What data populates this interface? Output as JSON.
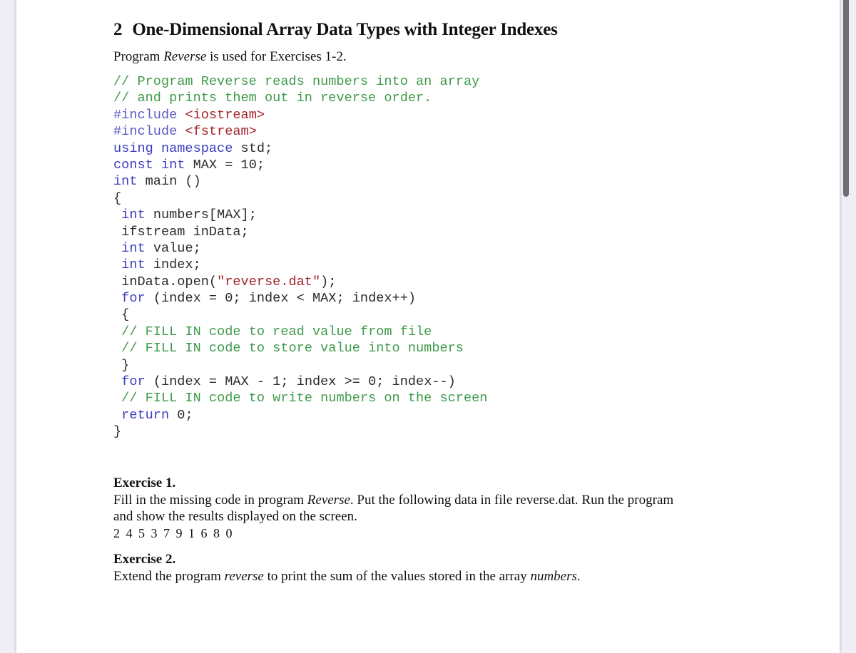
{
  "section": {
    "number": "2",
    "title": "One-Dimensional Array Data Types with Integer Indexes"
  },
  "intro": {
    "pre": "Program ",
    "italic": "Reverse",
    "post": " is used for Exercises 1-2."
  },
  "code": {
    "lines": [
      [
        {
          "t": "// Program Reverse reads numbers into an array",
          "c": "cm"
        }
      ],
      [
        {
          "t": "// and prints them out in reverse order.",
          "c": "cm"
        }
      ],
      [
        {
          "t": "#include",
          "c": "pp"
        },
        {
          "t": " ",
          "c": ""
        },
        {
          "t": "<iostream>",
          "c": "str"
        }
      ],
      [
        {
          "t": "#include",
          "c": "pp"
        },
        {
          "t": " ",
          "c": ""
        },
        {
          "t": "<fstream>",
          "c": "str"
        }
      ],
      [
        {
          "t": "using namespace",
          "c": "kw"
        },
        {
          "t": " std;",
          "c": ""
        }
      ],
      [
        {
          "t": "const int",
          "c": "kw"
        },
        {
          "t": " MAX = 10;",
          "c": ""
        }
      ],
      [
        {
          "t": "int",
          "c": "kw"
        },
        {
          "t": " main ()",
          "c": ""
        }
      ],
      [
        {
          "t": "{",
          "c": ""
        }
      ],
      [
        {
          "t": " ",
          "c": ""
        },
        {
          "t": "int",
          "c": "kw"
        },
        {
          "t": " numbers[MAX];",
          "c": ""
        }
      ],
      [
        {
          "t": " ifstream inData;",
          "c": ""
        }
      ],
      [
        {
          "t": " ",
          "c": ""
        },
        {
          "t": "int",
          "c": "kw"
        },
        {
          "t": " value;",
          "c": ""
        }
      ],
      [
        {
          "t": " ",
          "c": ""
        },
        {
          "t": "int",
          "c": "kw"
        },
        {
          "t": " index;",
          "c": ""
        }
      ],
      [
        {
          "t": " inData.open(",
          "c": ""
        },
        {
          "t": "\"reverse.dat\"",
          "c": "str"
        },
        {
          "t": ");",
          "c": ""
        }
      ],
      [
        {
          "t": " ",
          "c": ""
        },
        {
          "t": "for",
          "c": "kw"
        },
        {
          "t": " (index = 0; index < MAX; index++)",
          "c": ""
        }
      ],
      [
        {
          "t": " {",
          "c": ""
        }
      ],
      [
        {
          "t": " ",
          "c": ""
        },
        {
          "t": "// FILL IN code to read value from file",
          "c": "cm"
        }
      ],
      [
        {
          "t": " ",
          "c": ""
        },
        {
          "t": "// FILL IN code to store value into numbers",
          "c": "cm"
        }
      ],
      [
        {
          "t": " }",
          "c": ""
        }
      ],
      [
        {
          "t": " ",
          "c": ""
        },
        {
          "t": "for",
          "c": "kw"
        },
        {
          "t": " (index = MAX - 1; index >= 0; index--)",
          "c": ""
        }
      ],
      [
        {
          "t": " ",
          "c": ""
        },
        {
          "t": "// FILL IN code to write numbers on the screen",
          "c": "cm"
        }
      ],
      [
        {
          "t": " ",
          "c": ""
        },
        {
          "t": "return",
          "c": "kw"
        },
        {
          "t": " 0;",
          "c": ""
        }
      ],
      [
        {
          "t": "}",
          "c": ""
        }
      ]
    ]
  },
  "exercise1": {
    "title": "Exercise 1.",
    "line1_pre": "Fill in the missing code in program ",
    "line1_italic": "Reverse",
    "line1_post": ". Put the following data in file reverse.dat. Run the program",
    "line2": "and show the results displayed on the screen.",
    "data": "2 4 5 3 7 9 1 6 8 0"
  },
  "exercise2": {
    "title": "Exercise 2.",
    "pre": "Extend the program ",
    "italic1": "reverse",
    "mid": " to print the sum of the values stored in the array ",
    "italic2": "numbers",
    "post": "."
  }
}
